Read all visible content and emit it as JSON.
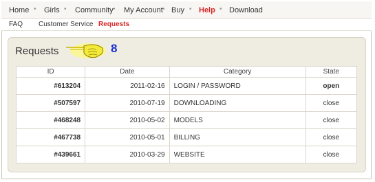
{
  "topnav": {
    "items": [
      "Home",
      "Girls",
      "Community",
      "My Account",
      "Buy",
      "Help",
      "Download"
    ],
    "separator": "•"
  },
  "subnav": {
    "items": [
      "FAQ",
      "Customer Service",
      "Requests"
    ]
  },
  "requests": {
    "title": "Requests",
    "count": "8",
    "columns": [
      "ID",
      "Date",
      "Category",
      "State"
    ],
    "rows": [
      {
        "id": "#613204",
        "date": "2011-02-16",
        "category": "LOGIN / PASSWORD",
        "state": "open"
      },
      {
        "id": "#507597",
        "date": "2010-07-19",
        "category": "DOWNLOADING",
        "state": "close"
      },
      {
        "id": "#468248",
        "date": "2010-05-02",
        "category": "MODELS",
        "state": "close"
      },
      {
        "id": "#467738",
        "date": "2010-05-01",
        "category": "BILLING",
        "state": "close"
      },
      {
        "id": "#439661",
        "date": "2010-03-29",
        "category": "WEBSITE",
        "state": "close"
      }
    ]
  },
  "colors": {
    "active": "#d62828",
    "open_state": "#1ea21e",
    "count": "#1a2fd6",
    "panel_bg": "#efece2"
  },
  "icons": {
    "pointer": "pointing-hand-icon"
  }
}
